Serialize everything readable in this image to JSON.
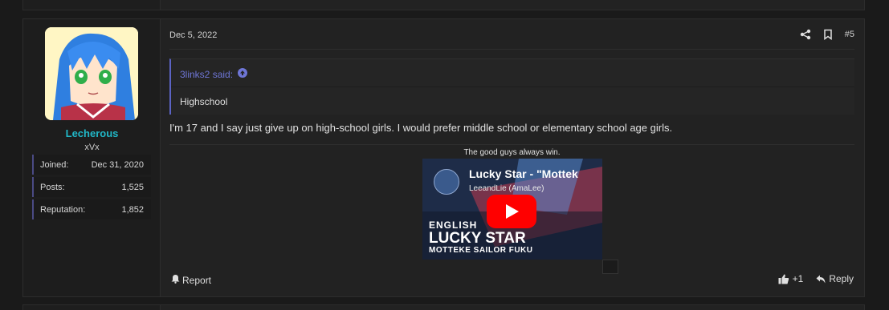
{
  "user": {
    "name": "Lecherous",
    "title": "xVx",
    "stats": [
      {
        "label": "Joined:",
        "value": "Dec 31, 2020"
      },
      {
        "label": "Posts:",
        "value": "1,525"
      },
      {
        "label": "Reputation:",
        "value": "1,852"
      }
    ]
  },
  "post": {
    "date": "Dec 5, 2022",
    "number": "#5",
    "quote": {
      "author_line": "3links2 said:",
      "text": "Highschool"
    },
    "message": "I'm 17 and I say just give up on high-school girls. I would prefer middle school or elementary school age girls.",
    "signature": "The good guys always win.",
    "video": {
      "title": "Lucky Star - \"Mottek",
      "channel": "LeeandLie (AmaLee)",
      "thumb_line1": "ENGLISH",
      "thumb_line2": "LUCKY STAR",
      "thumb_line3": "MOTTEKE SAILOR FUKU"
    }
  },
  "footer": {
    "report": "Report",
    "like": "+1",
    "reply": "Reply"
  },
  "colors": {
    "username": "#21b7c7",
    "quote_accent": "#5b63c4",
    "youtube_red": "#ff0000"
  }
}
